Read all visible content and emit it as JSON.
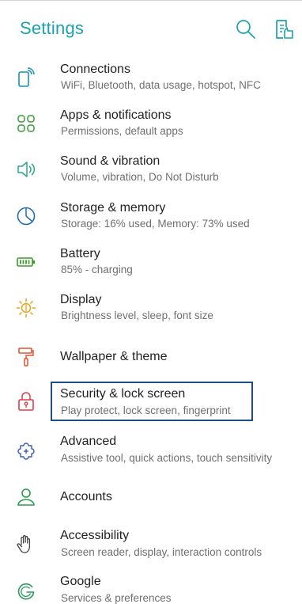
{
  "header": {
    "title": "Settings",
    "search_icon": "search-icon",
    "help_icon": "help-document-icon",
    "accent_color": "#1aa2b0"
  },
  "items": [
    {
      "title": "Connections",
      "subtitle": "WiFi, Bluetooth, data usage, hotspot, NFC",
      "icon": "connections-phone-icon",
      "icon_color": "#1a8fb8"
    },
    {
      "title": "Apps & notifications",
      "subtitle": "Permissions, default apps",
      "icon": "apps-grid-icon",
      "icon_color": "#3d9b3a"
    },
    {
      "title": "Sound & vibration",
      "subtitle": "Volume, vibration, Do Not Disturb",
      "icon": "speaker-icon",
      "icon_color": "#28a68f"
    },
    {
      "title": "Storage & memory",
      "subtitle": "Storage: 16% used, Memory: 73% used",
      "icon": "storage-pie-icon",
      "icon_color": "#1e6fb0"
    },
    {
      "title": "Battery",
      "subtitle": "85% - charging",
      "icon": "battery-icon",
      "icon_color": "#3a9b2a"
    },
    {
      "title": "Display",
      "subtitle": "Brightness level, sleep, font size",
      "icon": "brightness-icon",
      "icon_color": "#e8a317"
    },
    {
      "title": "Wallpaper & theme",
      "subtitle": "",
      "icon": "paint-roller-icon",
      "icon_color": "#e0552f"
    },
    {
      "title": "Security & lock screen",
      "subtitle": "Play protect, lock screen, fingerprint",
      "icon": "lock-icon",
      "icon_color": "#e23b4a"
    },
    {
      "title": "Advanced",
      "subtitle": "Assistive tool, quick actions, touch sensitivity",
      "icon": "puzzle-plus-icon",
      "icon_color": "#3c5bb0"
    },
    {
      "title": "Accounts",
      "subtitle": "",
      "icon": "person-icon",
      "icon_color": "#2a9b4a"
    },
    {
      "title": "Accessibility",
      "subtitle": "Screen reader, display, interaction controls",
      "icon": "hand-icon",
      "icon_color": "#444444"
    },
    {
      "title": "Google",
      "subtitle": "Services & preferences",
      "icon": "google-icon",
      "icon_color": "#2a9b5a"
    }
  ],
  "highlighted_item": "Security & lock screen",
  "highlight_color": "#1d4f86"
}
